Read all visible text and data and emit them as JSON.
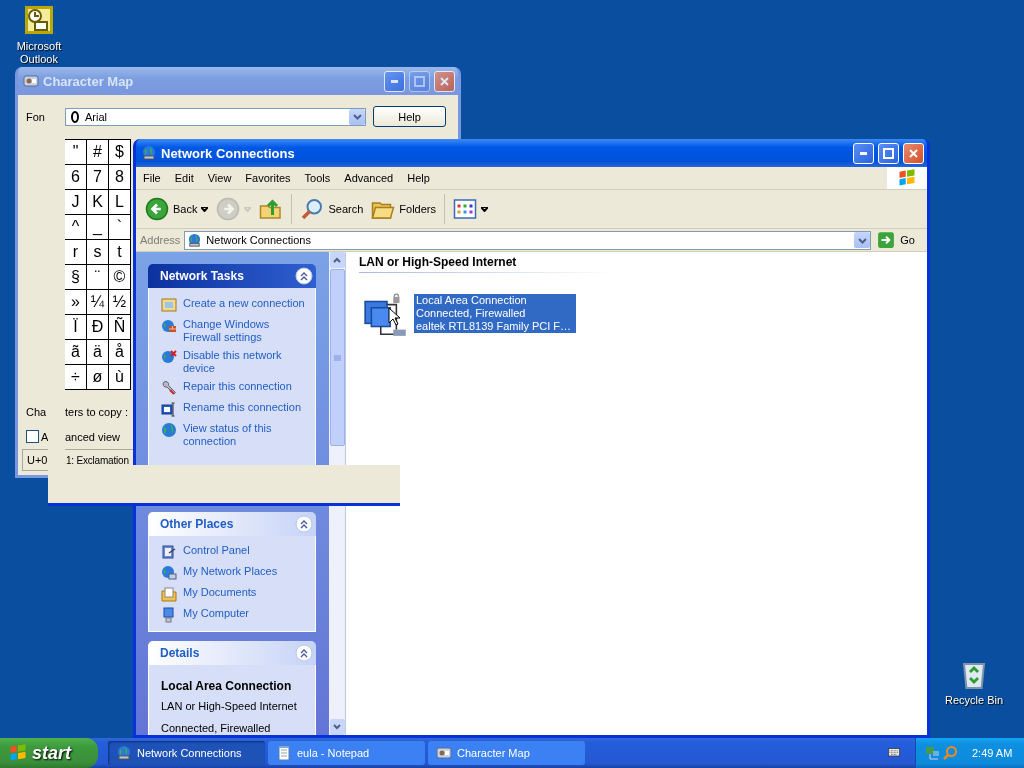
{
  "desktop": {
    "icons": [
      {
        "kind": "outlook",
        "label": "Microsoft Outlook"
      },
      {
        "kind": "recycle_bin",
        "label": "Recycle Bin"
      }
    ]
  },
  "character_map": {
    "title": "Character Map",
    "active": false,
    "maximize_enabled": false,
    "font_label": "Fon",
    "font_value": "Arial",
    "help_button": "Help",
    "grid": [
      [
        "\"",
        "#",
        "$"
      ],
      [
        "6",
        "7",
        "8"
      ],
      [
        "J",
        "K",
        "L"
      ],
      [
        "^",
        "_",
        "`"
      ],
      [
        "r",
        "s",
        "t"
      ],
      [
        "§",
        "¨",
        "©"
      ],
      [
        "»",
        "¼",
        "½"
      ],
      [
        "Ï",
        "Ð",
        "Ñ"
      ],
      [
        "ã",
        "ä",
        "å"
      ],
      [
        "÷",
        "ø",
        "ù"
      ]
    ],
    "copy_label": [
      "Cha",
      "ters to copy :"
    ],
    "advanced_view": {
      "label": [
        "A",
        "anced view"
      ],
      "checked": false
    },
    "status": [
      "U+0",
      "1: Exclamation"
    ]
  },
  "network_connections": {
    "title": "Network Connections",
    "active": true,
    "maximize_enabled": true,
    "menu": [
      "File",
      "Edit",
      "View",
      "Favorites",
      "Tools",
      "Advanced",
      "Help"
    ],
    "toolbar": [
      {
        "kind": "back",
        "label": "Back",
        "disabled": false
      },
      {
        "kind": "forward",
        "disabled": true
      },
      {
        "kind": "up",
        "disabled": false
      },
      {
        "kind": "search",
        "label": "Search",
        "disabled": false
      },
      {
        "kind": "folders",
        "label": "Folders",
        "disabled": false
      },
      {
        "kind": "views",
        "disabled": false
      }
    ],
    "address": {
      "label": "Address",
      "value": "Network Connections",
      "go": "Go"
    },
    "task_panes": [
      {
        "kind": "list",
        "title": "Network Tasks",
        "special": true,
        "expanded": true,
        "items": [
          {
            "kind": "new_connection",
            "label": "Create a new connection"
          },
          {
            "kind": "firewall",
            "label": "Change Windows Firewall settings"
          },
          {
            "kind": "disable",
            "label": "Disable this network device"
          },
          {
            "kind": "repair",
            "label": "Repair this connection"
          },
          {
            "kind": "rename",
            "label": "Rename this connection"
          },
          {
            "kind": "status",
            "label": "View status of this connection"
          }
        ]
      },
      {
        "kind": "list",
        "title": "Other Places",
        "special": false,
        "expanded": true,
        "items": [
          {
            "kind": "control_panel",
            "label": "Control Panel"
          },
          {
            "kind": "network_places",
            "label": "My Network Places"
          },
          {
            "kind": "documents",
            "label": "My Documents"
          },
          {
            "kind": "computer",
            "label": "My Computer"
          }
        ]
      },
      {
        "kind": "details",
        "title": "Details",
        "special": false,
        "expanded": true,
        "heading": "Local Area Connection",
        "lines": [
          "LAN or High-Speed Internet",
          "Connected, Firewalled"
        ]
      }
    ],
    "content": {
      "group": "LAN or High-Speed Internet",
      "items": [
        {
          "name": "Local Area Connection",
          "status": "Connected, Firewalled",
          "device": "ealtek RTL8139 Family PCI F…",
          "selected": true
        }
      ]
    }
  },
  "taskbar": {
    "start": "start",
    "tasks": [
      {
        "kind": "network",
        "label": "Network Connections",
        "selected": true
      },
      {
        "kind": "notepad",
        "label": "eula - Notepad",
        "selected": false
      },
      {
        "kind": "charmap",
        "label": "Character Map",
        "selected": false
      }
    ],
    "clock": "2:49 AM"
  }
}
